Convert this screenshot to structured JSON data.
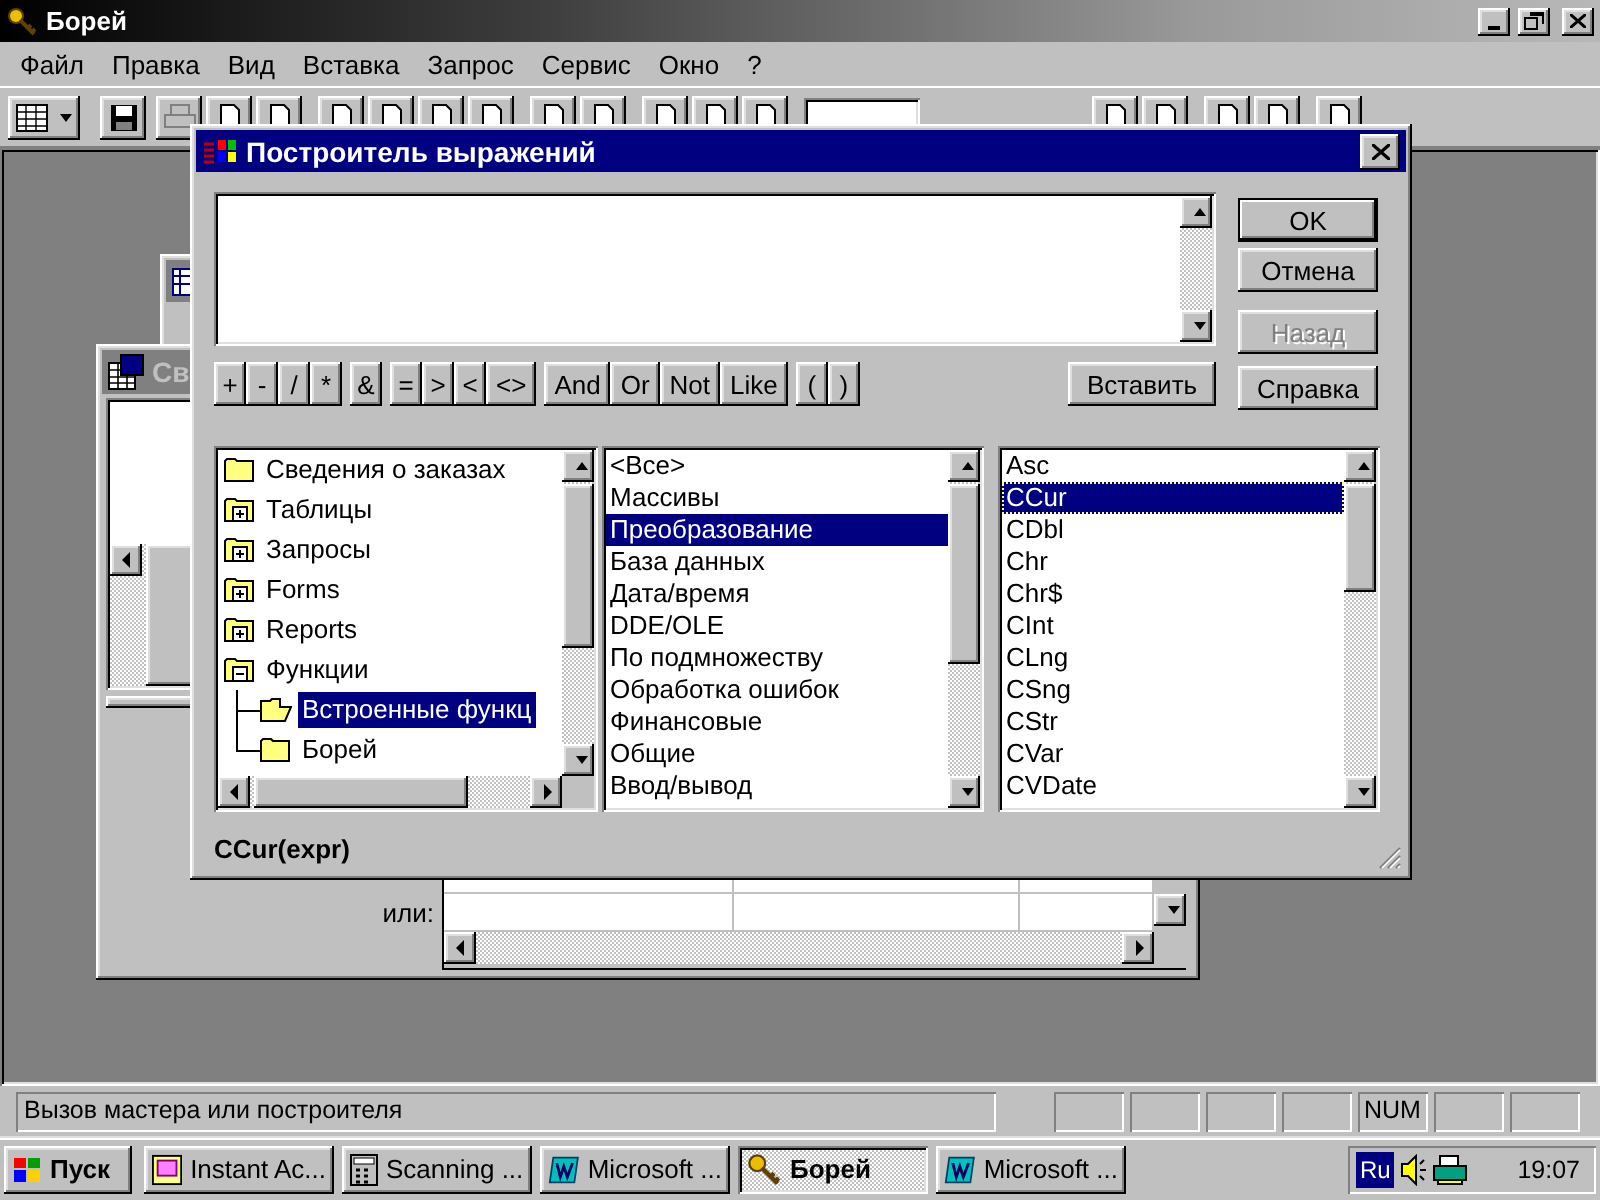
{
  "app_window": {
    "title": "Борей"
  },
  "menu": [
    "Файл",
    "Правка",
    "Вид",
    "Вставка",
    "Запрос",
    "Сервис",
    "Окно",
    "?"
  ],
  "query_window": {
    "title": "Св",
    "criteria_label": "или:"
  },
  "dialog": {
    "title": "Построитель выражений",
    "buttons": [
      {
        "label": "OK",
        "kind": "default",
        "disabled": false
      },
      {
        "label": "Отмена",
        "kind": "normal",
        "disabled": false
      },
      {
        "label": "Назад",
        "kind": "normal",
        "disabled": true
      },
      {
        "label": "Справка",
        "kind": "normal",
        "disabled": false
      }
    ],
    "operator_groups": [
      [
        "+",
        "-",
        "/",
        "*"
      ],
      [
        "&"
      ],
      [
        "=",
        ">",
        "<",
        "<>"
      ],
      [
        "And",
        "Or",
        "Not",
        "Like"
      ],
      [
        "(",
        ")"
      ]
    ],
    "insert_button": "Вставить",
    "tree": [
      {
        "label": "Сведения о заказах",
        "kind": "folder",
        "selected": false
      },
      {
        "label": "Таблицы",
        "kind": "group",
        "expanded": false,
        "selected": false
      },
      {
        "label": "Запросы",
        "kind": "group",
        "expanded": false,
        "selected": false
      },
      {
        "label": "Forms",
        "kind": "group",
        "expanded": false,
        "selected": false
      },
      {
        "label": "Reports",
        "kind": "group",
        "expanded": false,
        "selected": false
      },
      {
        "label": "Функции",
        "kind": "group",
        "expanded": true,
        "selected": false,
        "children": [
          {
            "label": "Встроенные функц",
            "kind": "folder",
            "selected": true
          },
          {
            "label": "Борей",
            "kind": "folder",
            "selected": false
          }
        ]
      }
    ],
    "categories": [
      {
        "label": "<Все>",
        "selected": false
      },
      {
        "label": "Массивы",
        "selected": false
      },
      {
        "label": "Преобразование",
        "selected": true
      },
      {
        "label": "База данных",
        "selected": false
      },
      {
        "label": "Дата/время",
        "selected": false
      },
      {
        "label": "DDE/OLE",
        "selected": false
      },
      {
        "label": "По подмножеству",
        "selected": false
      },
      {
        "label": "Обработка ошибок",
        "selected": false
      },
      {
        "label": "Финансовые",
        "selected": false
      },
      {
        "label": "Общие",
        "selected": false
      },
      {
        "label": "Ввод/вывод",
        "selected": false
      }
    ],
    "functions": [
      {
        "label": "Asc",
        "selected": false
      },
      {
        "label": "CCur",
        "selected": true
      },
      {
        "label": "CDbl",
        "selected": false
      },
      {
        "label": "Chr",
        "selected": false
      },
      {
        "label": "Chr$",
        "selected": false
      },
      {
        "label": "CInt",
        "selected": false
      },
      {
        "label": "CLng",
        "selected": false
      },
      {
        "label": "CSng",
        "selected": false
      },
      {
        "label": "CStr",
        "selected": false
      },
      {
        "label": "CVar",
        "selected": false
      },
      {
        "label": "CVDate",
        "selected": false
      }
    ],
    "syntax": "CCur(expr)"
  },
  "status_bar": {
    "message": "Вызов мастера или построителя",
    "indicators": [
      "NUM"
    ]
  },
  "taskbar": {
    "start": "Пуск",
    "tasks": [
      {
        "label": "Instant Ac...",
        "kind": "viewer",
        "selected": false
      },
      {
        "label": "Scanning ...",
        "kind": "scanner",
        "selected": false
      },
      {
        "label": "Microsoft ...",
        "kind": "editor",
        "selected": false
      },
      {
        "label": "Борей",
        "kind": "database",
        "selected": true
      },
      {
        "label": "Microsoft ...",
        "kind": "editor",
        "selected": false
      }
    ],
    "tray": {
      "language": "Ru",
      "clock": "19:07"
    }
  }
}
